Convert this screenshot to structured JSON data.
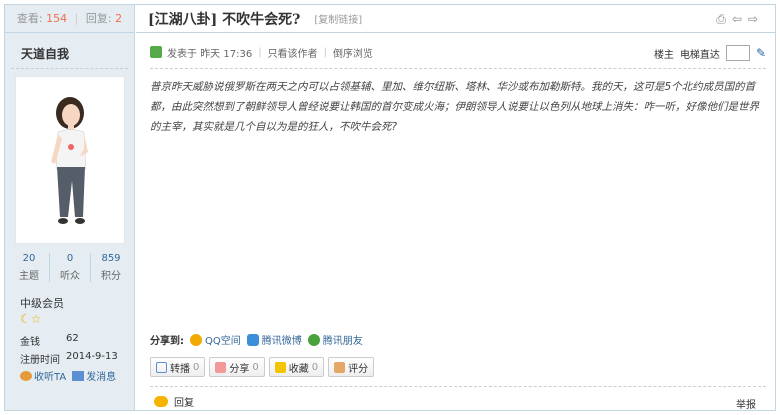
{
  "sidebar": {
    "views_label": "查看:",
    "views": "154",
    "replies_label": "回复:",
    "replies": "2",
    "username": "天道自我",
    "stats": [
      {
        "value": "20",
        "label": "主题"
      },
      {
        "value": "0",
        "label": "听众"
      },
      {
        "value": "859",
        "label": "积分"
      }
    ],
    "rank": "中级会员",
    "info": [
      {
        "key": "金钱",
        "value": "62"
      },
      {
        "key": "注册时间",
        "value": "2014-9-13"
      }
    ],
    "actions": [
      {
        "label": "收听TA",
        "icon": "listen-icon"
      },
      {
        "label": "发消息",
        "icon": "mail-icon"
      }
    ]
  },
  "thread": {
    "title": "[江湖八卦] 不吹牛会死?",
    "copy_link": "[复制链接]",
    "posted_label": "发表于",
    "posted_time": "昨天 17:36",
    "only_author": "只看该作者",
    "reverse": "倒序浏览",
    "floor_label": "楼主",
    "jump_label": "电梯直达",
    "content": "普京昨天威胁说俄罗斯在两天之内可以占领基辅、里加、维尔纽斯、塔林、华沙或布加勒斯特。我的天，这可是5个北约成员国的首都，由此突然想到了朝鲜领导人曾经说要让韩国的首尔变成火海；伊朗领导人说要让以色列从地球上消失：咋一听，好像他们是世界的主宰，其实就是几个自以为是的狂人，不吹牛会死?"
  },
  "share": {
    "label": "分享到:",
    "items": [
      {
        "label": "QQ空间",
        "color": "#f2a900"
      },
      {
        "label": "腾讯微博",
        "color": "#3b8ed8"
      },
      {
        "label": "腾讯朋友",
        "color": "#4aa23a"
      }
    ]
  },
  "buttons": [
    {
      "label": "转播",
      "count": "0",
      "color": "#5b8fd1"
    },
    {
      "label": "分享",
      "count": "0",
      "color": "#e55"
    },
    {
      "label": "收藏",
      "count": "0",
      "color": "#e8b100"
    },
    {
      "label": "评分",
      "count": "",
      "color": "#d88a3c"
    }
  ],
  "footer": {
    "reply": "回复",
    "report": "举报"
  }
}
